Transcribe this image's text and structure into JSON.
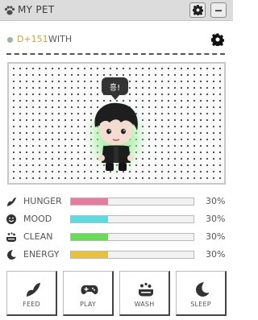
{
  "window": {
    "title": "MY PET",
    "icon": "paw-icon",
    "buttons": {
      "settings": "gear-icon",
      "minimize": "minimize-icon"
    }
  },
  "header": {
    "dday": "D+151",
    "with_label": "WITH",
    "settings_icon": "gear-icon"
  },
  "pet": {
    "speech": "흥!",
    "glow_color": "#7de37a"
  },
  "stats": [
    {
      "label": "HUNGER",
      "value_text": "30%",
      "fill": 0.3,
      "color": "#e77ba0",
      "icon": "hunger-icon"
    },
    {
      "label": "MOOD",
      "value_text": "30%",
      "fill": 0.3,
      "color": "#56dde4",
      "icon": "mood-icon"
    },
    {
      "label": "CLEAN",
      "value_text": "30%",
      "fill": 0.3,
      "color": "#66dd55",
      "icon": "clean-icon"
    },
    {
      "label": "ENERGY",
      "value_text": "30%",
      "fill": 0.3,
      "color": "#e8c33a",
      "icon": "energy-icon"
    }
  ],
  "actions": [
    {
      "label": "FEED",
      "icon": "feed-icon"
    },
    {
      "label": "PLAY",
      "icon": "gamepad-icon"
    },
    {
      "label": "WASH",
      "icon": "wash-icon"
    },
    {
      "label": "SLEEP",
      "icon": "moon-icon"
    }
  ]
}
